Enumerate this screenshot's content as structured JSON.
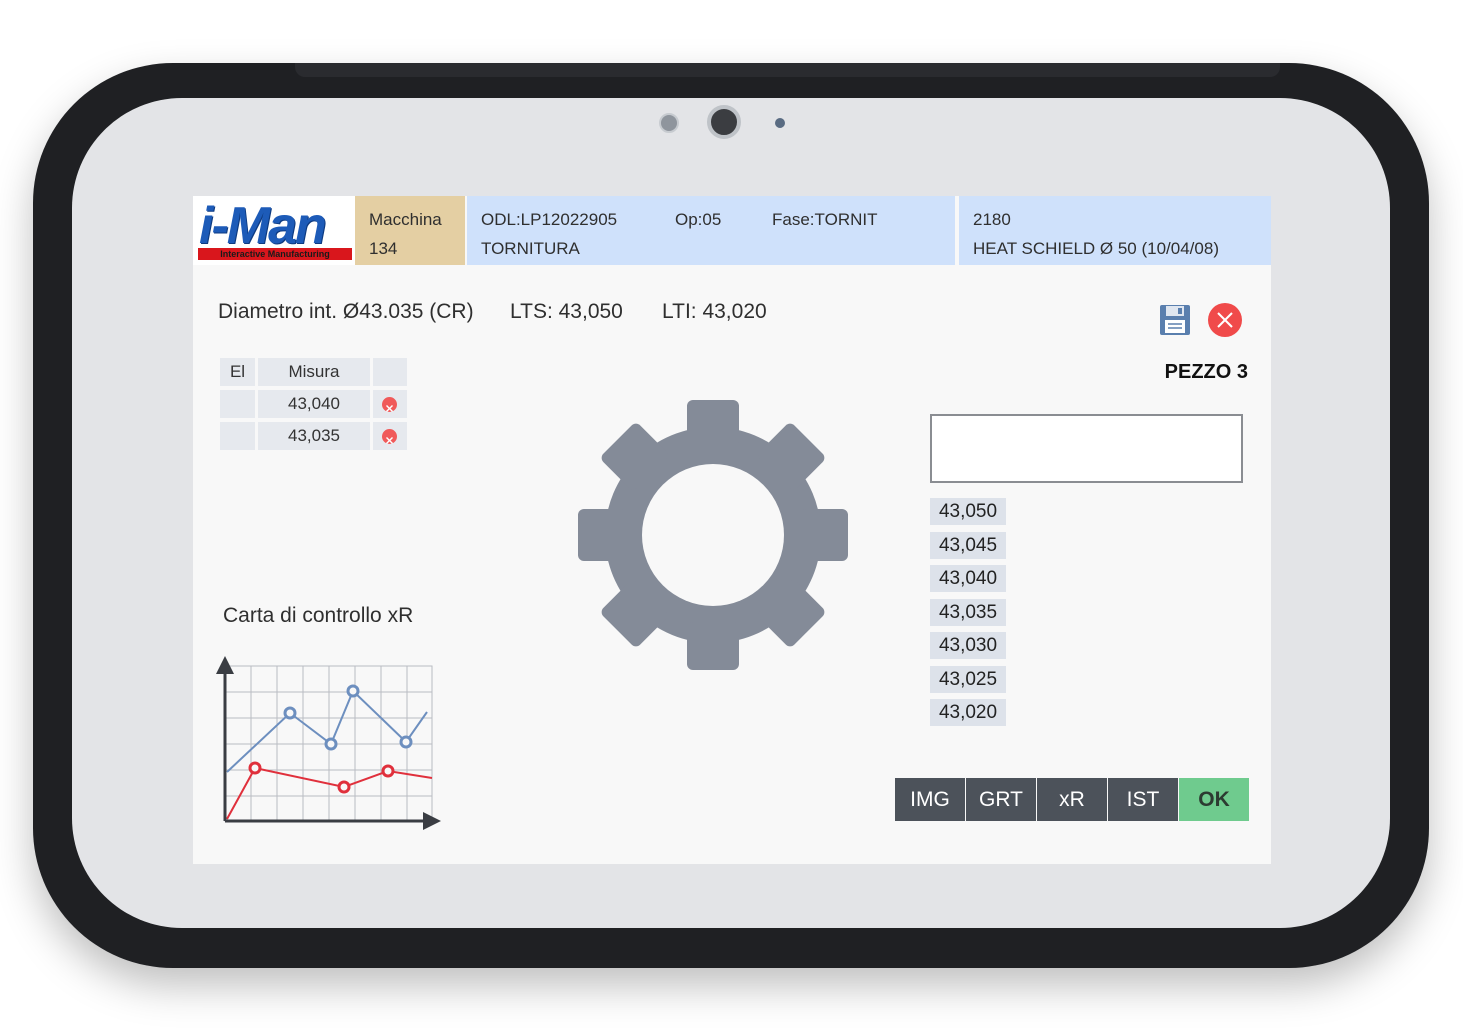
{
  "app": {
    "logo_text": "i-Man",
    "logo_subtitle": "Interactive Manufacturing"
  },
  "header": {
    "macchina_label": "Macchina",
    "macchina_value": "134",
    "odl": "ODL:LP12022905",
    "op": "Op:05",
    "fase": "Fase:TORNIT",
    "lavorazione": "TORNITURA",
    "part_code": "2180",
    "part_desc": "HEAT SCHIELD Ø 50 (10/04/08)"
  },
  "measure": {
    "title": "Diametro int. Ø43.035 (CR)",
    "lts": "LTS: 43,050",
    "lti": "LTI: 43,020",
    "pezzo": "PEZZO 3"
  },
  "table": {
    "col_el": "El",
    "col_misura": "Misura",
    "rows": [
      {
        "el": "",
        "misura": "43,040"
      },
      {
        "el": "",
        "misura": "43,035"
      }
    ]
  },
  "input": {
    "value": ""
  },
  "values": [
    "43,050",
    "43,045",
    "43,040",
    "43,035",
    "43,030",
    "43,025",
    "43,020"
  ],
  "chart": {
    "title": "Carta di controllo xR"
  },
  "buttons": {
    "img": "IMG",
    "grt": "GRT",
    "xr": "xR",
    "ist": "IST",
    "ok": "OK"
  },
  "icons": {
    "save": "floppy-disk-icon",
    "close": "close-icon",
    "gear": "gear-icon",
    "remove": "remove-icon"
  },
  "colors": {
    "header_blue": "#cfe1fb",
    "header_tan": "#e4cfa3",
    "ok_green": "#6fcb8e",
    "button_dark": "#4c525a",
    "close_red": "#f04a4a",
    "series_blue": "#6d8fbf",
    "series_red": "#e0303c"
  }
}
